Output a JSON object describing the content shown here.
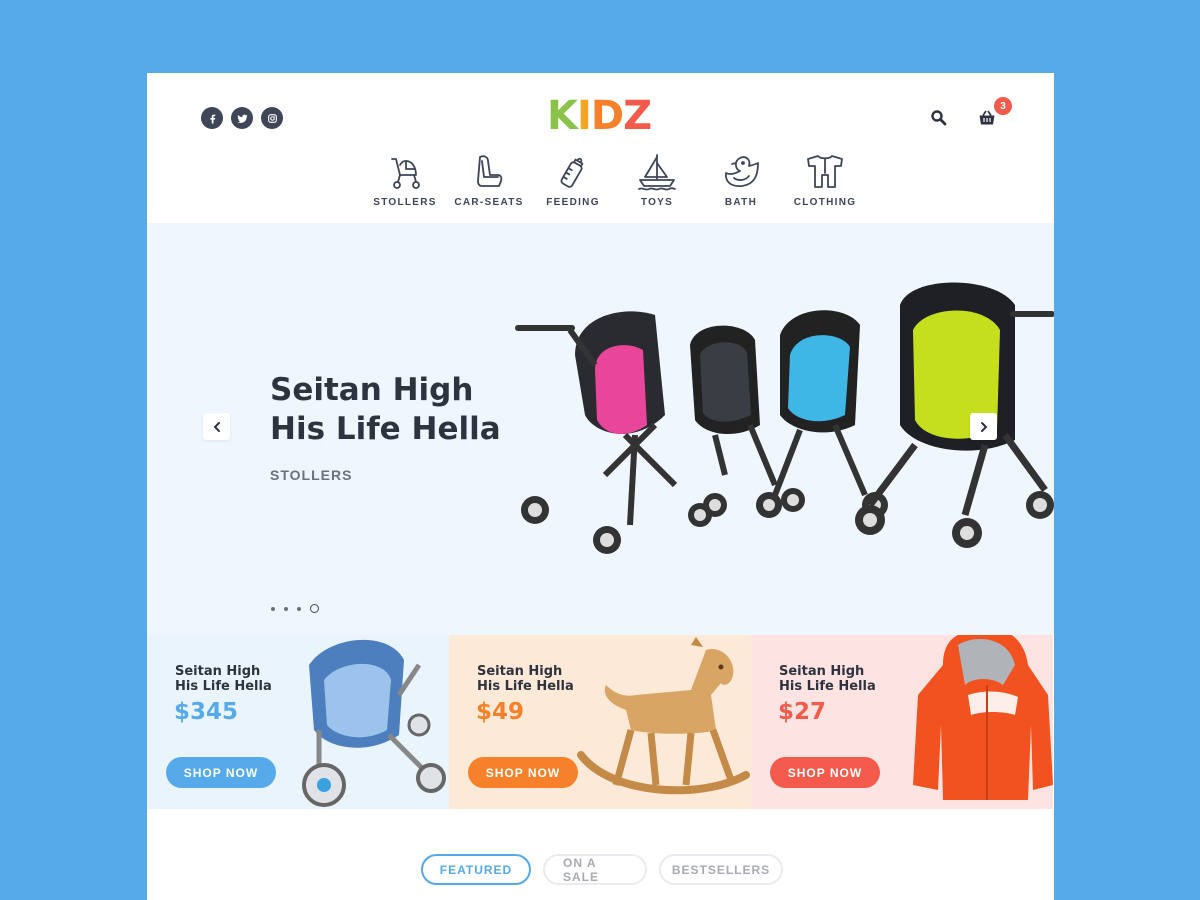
{
  "brand": {
    "logo_letters": [
      {
        "char": "K",
        "color": "#8bc34a"
      },
      {
        "char": "I",
        "color": "#f5a623"
      },
      {
        "char": "D",
        "color": "#f7802a"
      },
      {
        "char": "Z",
        "color": "#f45b4c"
      }
    ]
  },
  "header": {
    "socials": [
      "f",
      "twitter",
      "instagram"
    ],
    "cart_count": "3"
  },
  "categories": [
    {
      "label": "STOLLERS",
      "icon": "stroller-icon"
    },
    {
      "label": "CAR-SEATS",
      "icon": "car-seat-icon"
    },
    {
      "label": "FEEDING",
      "icon": "bottle-icon"
    },
    {
      "label": "TOYS",
      "icon": "boat-icon"
    },
    {
      "label": "BATH",
      "icon": "duck-icon"
    },
    {
      "label": "CLOTHING",
      "icon": "onesie-icon"
    }
  ],
  "hero": {
    "title_line1": "Seitan High",
    "title_line2": "His Life Hella",
    "subtitle": "STOLLERS",
    "slide_count": 4,
    "active_slide": 4
  },
  "promos": [
    {
      "name_line1": "Seitan High",
      "name_line2": "His Life Hella",
      "price": "$345",
      "button": "SHOP NOW",
      "accent": "#56aaea",
      "bg": "#eaf4fd"
    },
    {
      "name_line1": "Seitan High",
      "name_line2": "His Life Hella",
      "price": "$49",
      "button": "SHOP NOW",
      "accent": "#f7802a",
      "bg": "#fde9d8"
    },
    {
      "name_line1": "Seitan High",
      "name_line2": "His Life Hella",
      "price": "$27",
      "button": "SHOP NOW",
      "accent": "#f45b4c",
      "bg": "#fde3e1"
    }
  ],
  "tabs": [
    {
      "label": "FEATURED",
      "active": true
    },
    {
      "label": "ON A SALE",
      "active": false
    },
    {
      "label": "BESTSELLERS",
      "active": false
    }
  ],
  "colors": {
    "page_bg": "#56aaea",
    "text_dark": "#2f3340",
    "icon_dark": "#3e4657"
  }
}
